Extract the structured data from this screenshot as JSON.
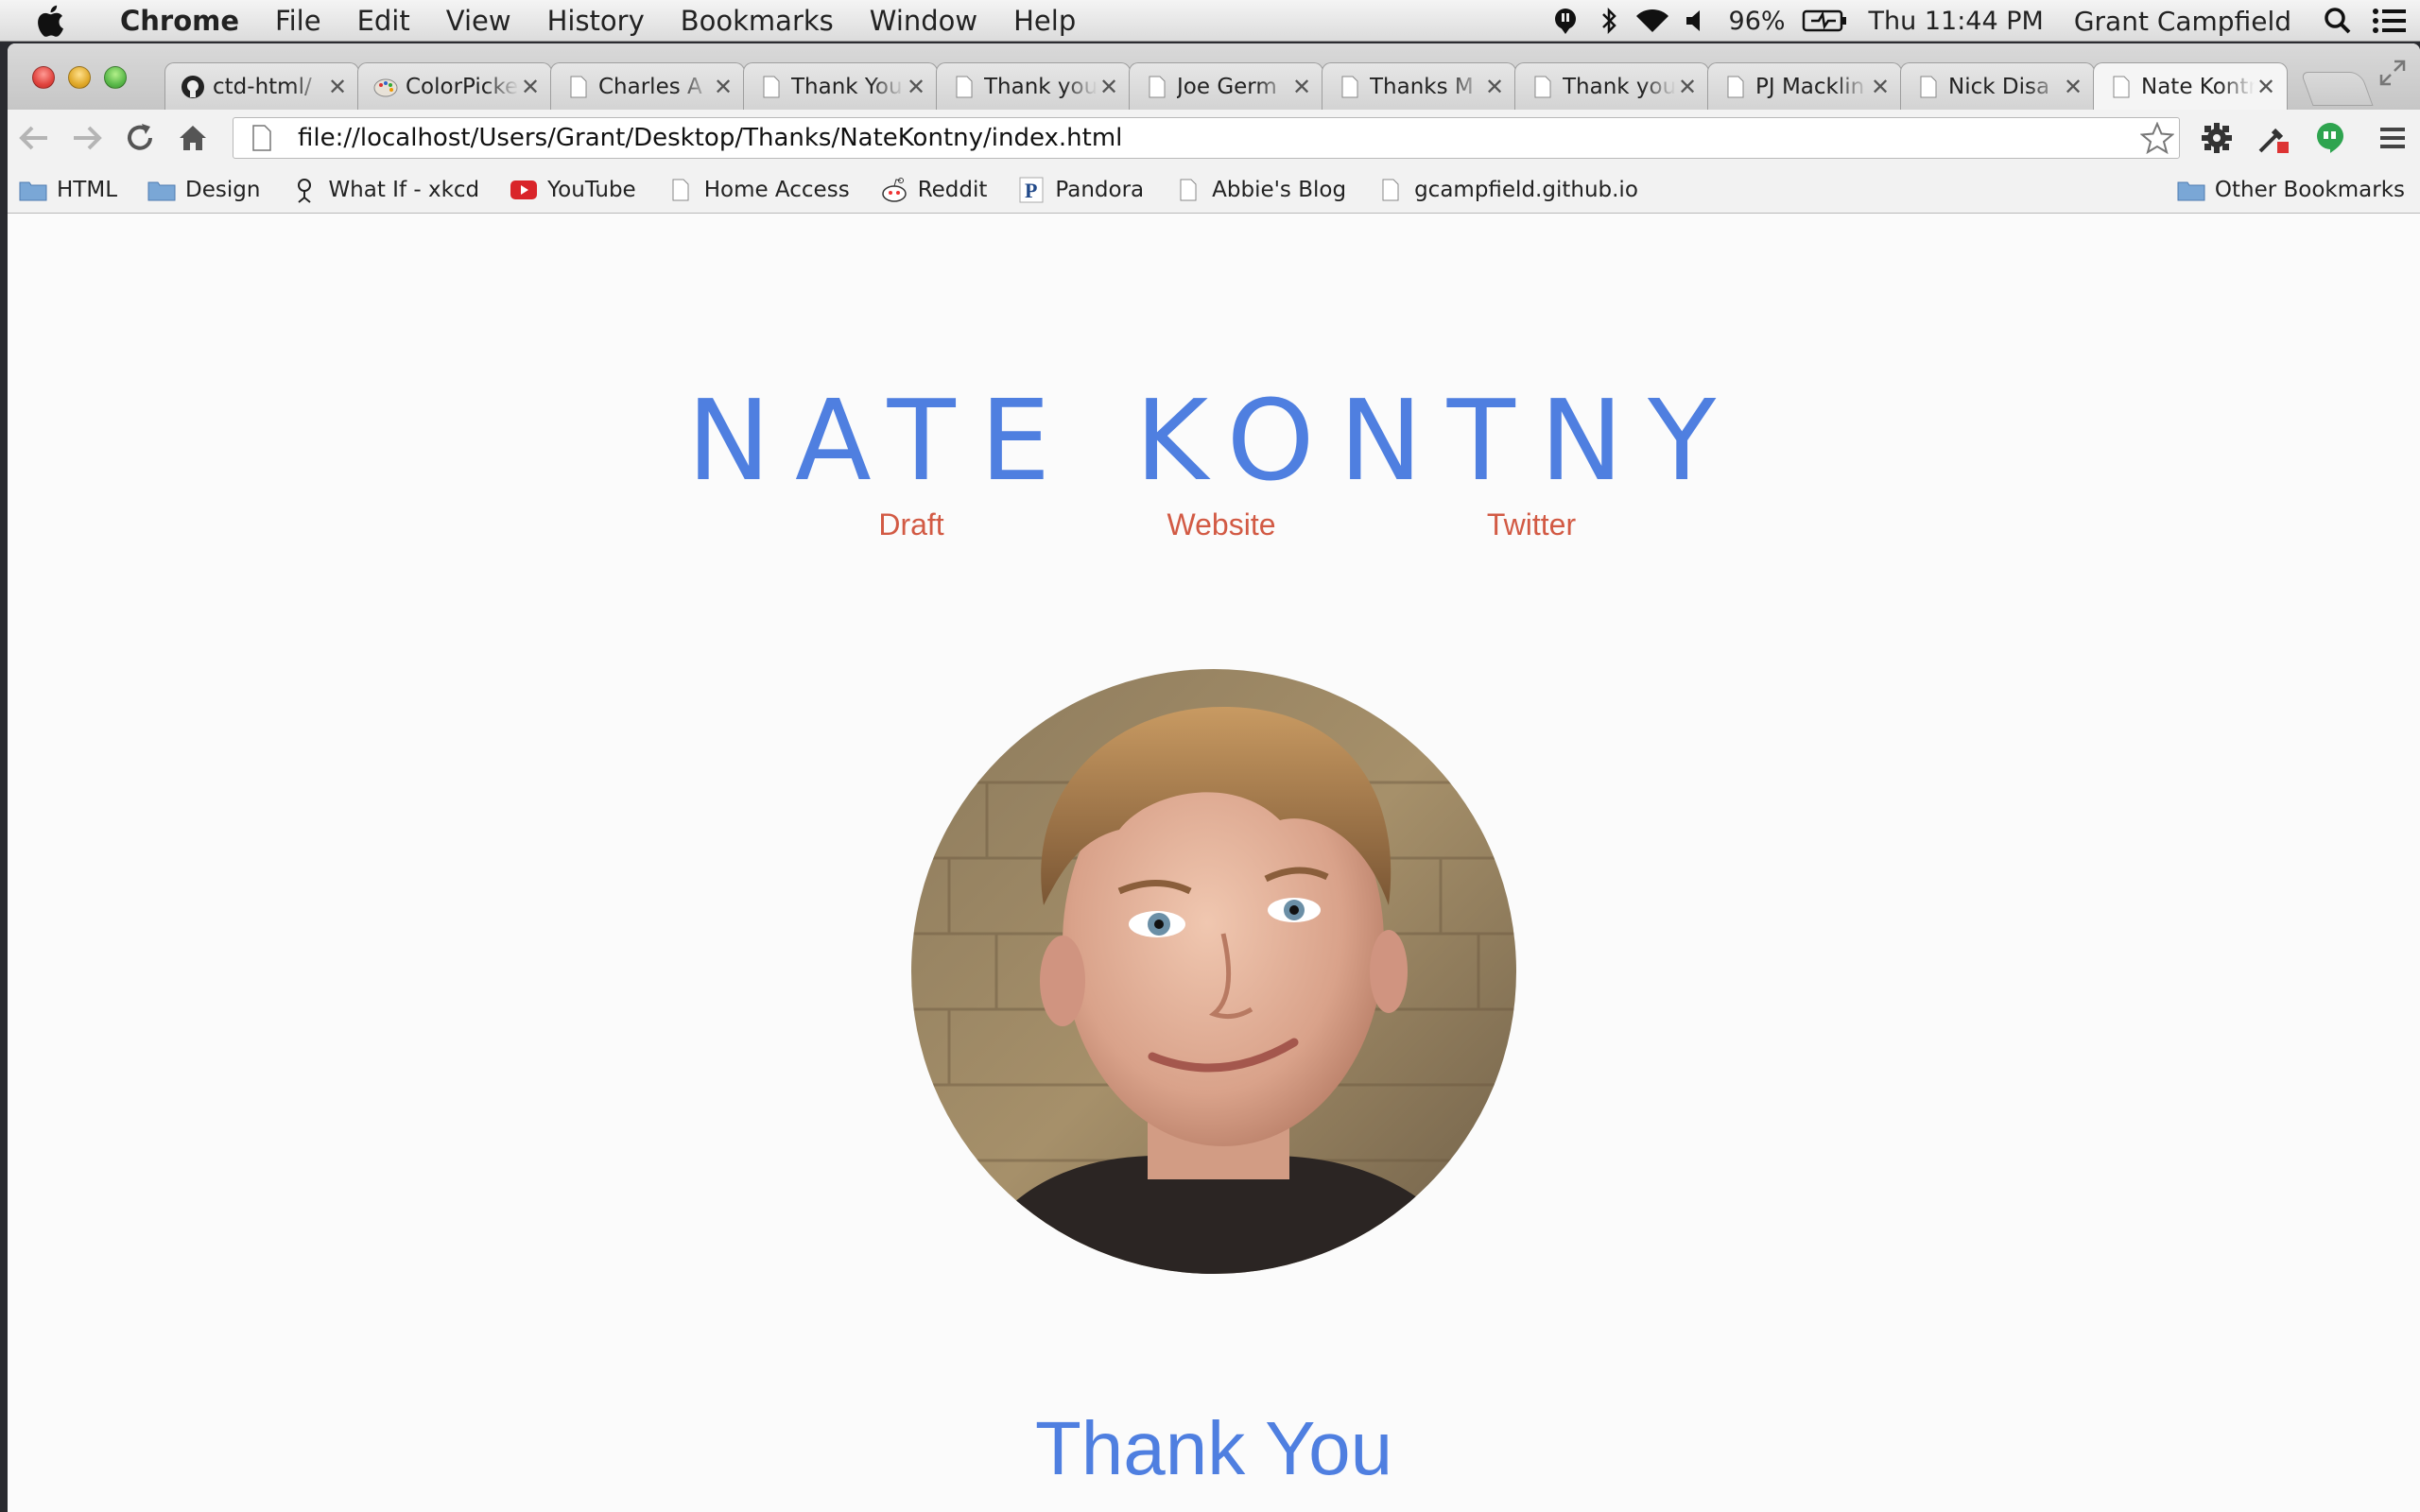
{
  "menubar": {
    "app_name": "Chrome",
    "items": [
      "File",
      "Edit",
      "View",
      "History",
      "Bookmarks",
      "Window",
      "Help"
    ],
    "battery": "96%",
    "clock": "Thu 11:44 PM",
    "user": "Grant Campfield"
  },
  "tabs": [
    {
      "title": "ctd-html/",
      "icon": "github-icon"
    },
    {
      "title": "ColorPicker",
      "icon": "palette-icon"
    },
    {
      "title": "Charles A",
      "icon": "page-icon"
    },
    {
      "title": "Thank You",
      "icon": "page-icon"
    },
    {
      "title": "Thank you",
      "icon": "page-icon"
    },
    {
      "title": "Joe Germ",
      "icon": "page-icon"
    },
    {
      "title": "Thanks M",
      "icon": "page-icon"
    },
    {
      "title": "Thank you",
      "icon": "page-icon"
    },
    {
      "title": "PJ Macklin",
      "icon": "page-icon"
    },
    {
      "title": "Nick Disa",
      "icon": "page-icon"
    },
    {
      "title": "Nate Kontny",
      "icon": "page-icon",
      "active": true
    }
  ],
  "toolbar": {
    "url": "file://localhost/Users/Grant/Desktop/Thanks/NateKontny/index.html"
  },
  "bookmarks": [
    {
      "label": "HTML",
      "icon": "folder-icon"
    },
    {
      "label": "Design",
      "icon": "folder-icon"
    },
    {
      "label": "What If - xkcd",
      "icon": "xkcd-icon"
    },
    {
      "label": "YouTube",
      "icon": "youtube-icon"
    },
    {
      "label": "Home Access",
      "icon": "page-icon"
    },
    {
      "label": "Reddit",
      "icon": "reddit-icon"
    },
    {
      "label": "Pandora",
      "icon": "pandora-icon"
    },
    {
      "label": "Abbie's Blog",
      "icon": "page-icon"
    },
    {
      "label": "gcampfield.github.io",
      "icon": "page-icon"
    }
  ],
  "other_bookmarks": "Other Bookmarks",
  "page": {
    "name": "NATE KONTNY",
    "links": [
      "Draft",
      "Website",
      "Twitter"
    ],
    "thank_you": "Thank You"
  },
  "colors": {
    "heading_blue": "#4f7fe0",
    "link_red": "#d25a44",
    "background": "#fbfbfb"
  }
}
